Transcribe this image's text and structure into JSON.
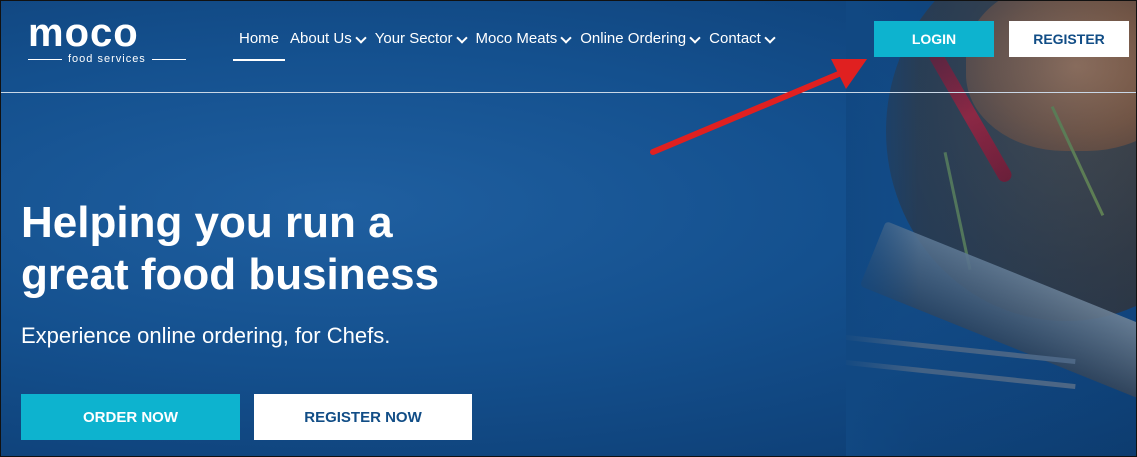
{
  "logo": {
    "word": "moco",
    "tagline": "food services"
  },
  "nav": {
    "items": [
      {
        "label": "Home",
        "dropdown": false
      },
      {
        "label": "About Us",
        "dropdown": true
      },
      {
        "label": "Your Sector",
        "dropdown": true
      },
      {
        "label": "Moco Meats",
        "dropdown": true
      },
      {
        "label": "Online Ordering",
        "dropdown": true
      },
      {
        "label": "Contact",
        "dropdown": true
      }
    ]
  },
  "header_buttons": {
    "login": "LOGIN",
    "register": "REGISTER"
  },
  "hero": {
    "title_line1": "Helping you run a",
    "title_line2": "great food business",
    "subtitle": "Experience online ordering, for Chefs.",
    "order_button": "ORDER NOW",
    "register_button": "REGISTER NOW"
  },
  "colors": {
    "accent": "#0db3cf",
    "background": "#14508e",
    "button_text_dark": "#114d86",
    "annotation_arrow": "#e02020"
  }
}
